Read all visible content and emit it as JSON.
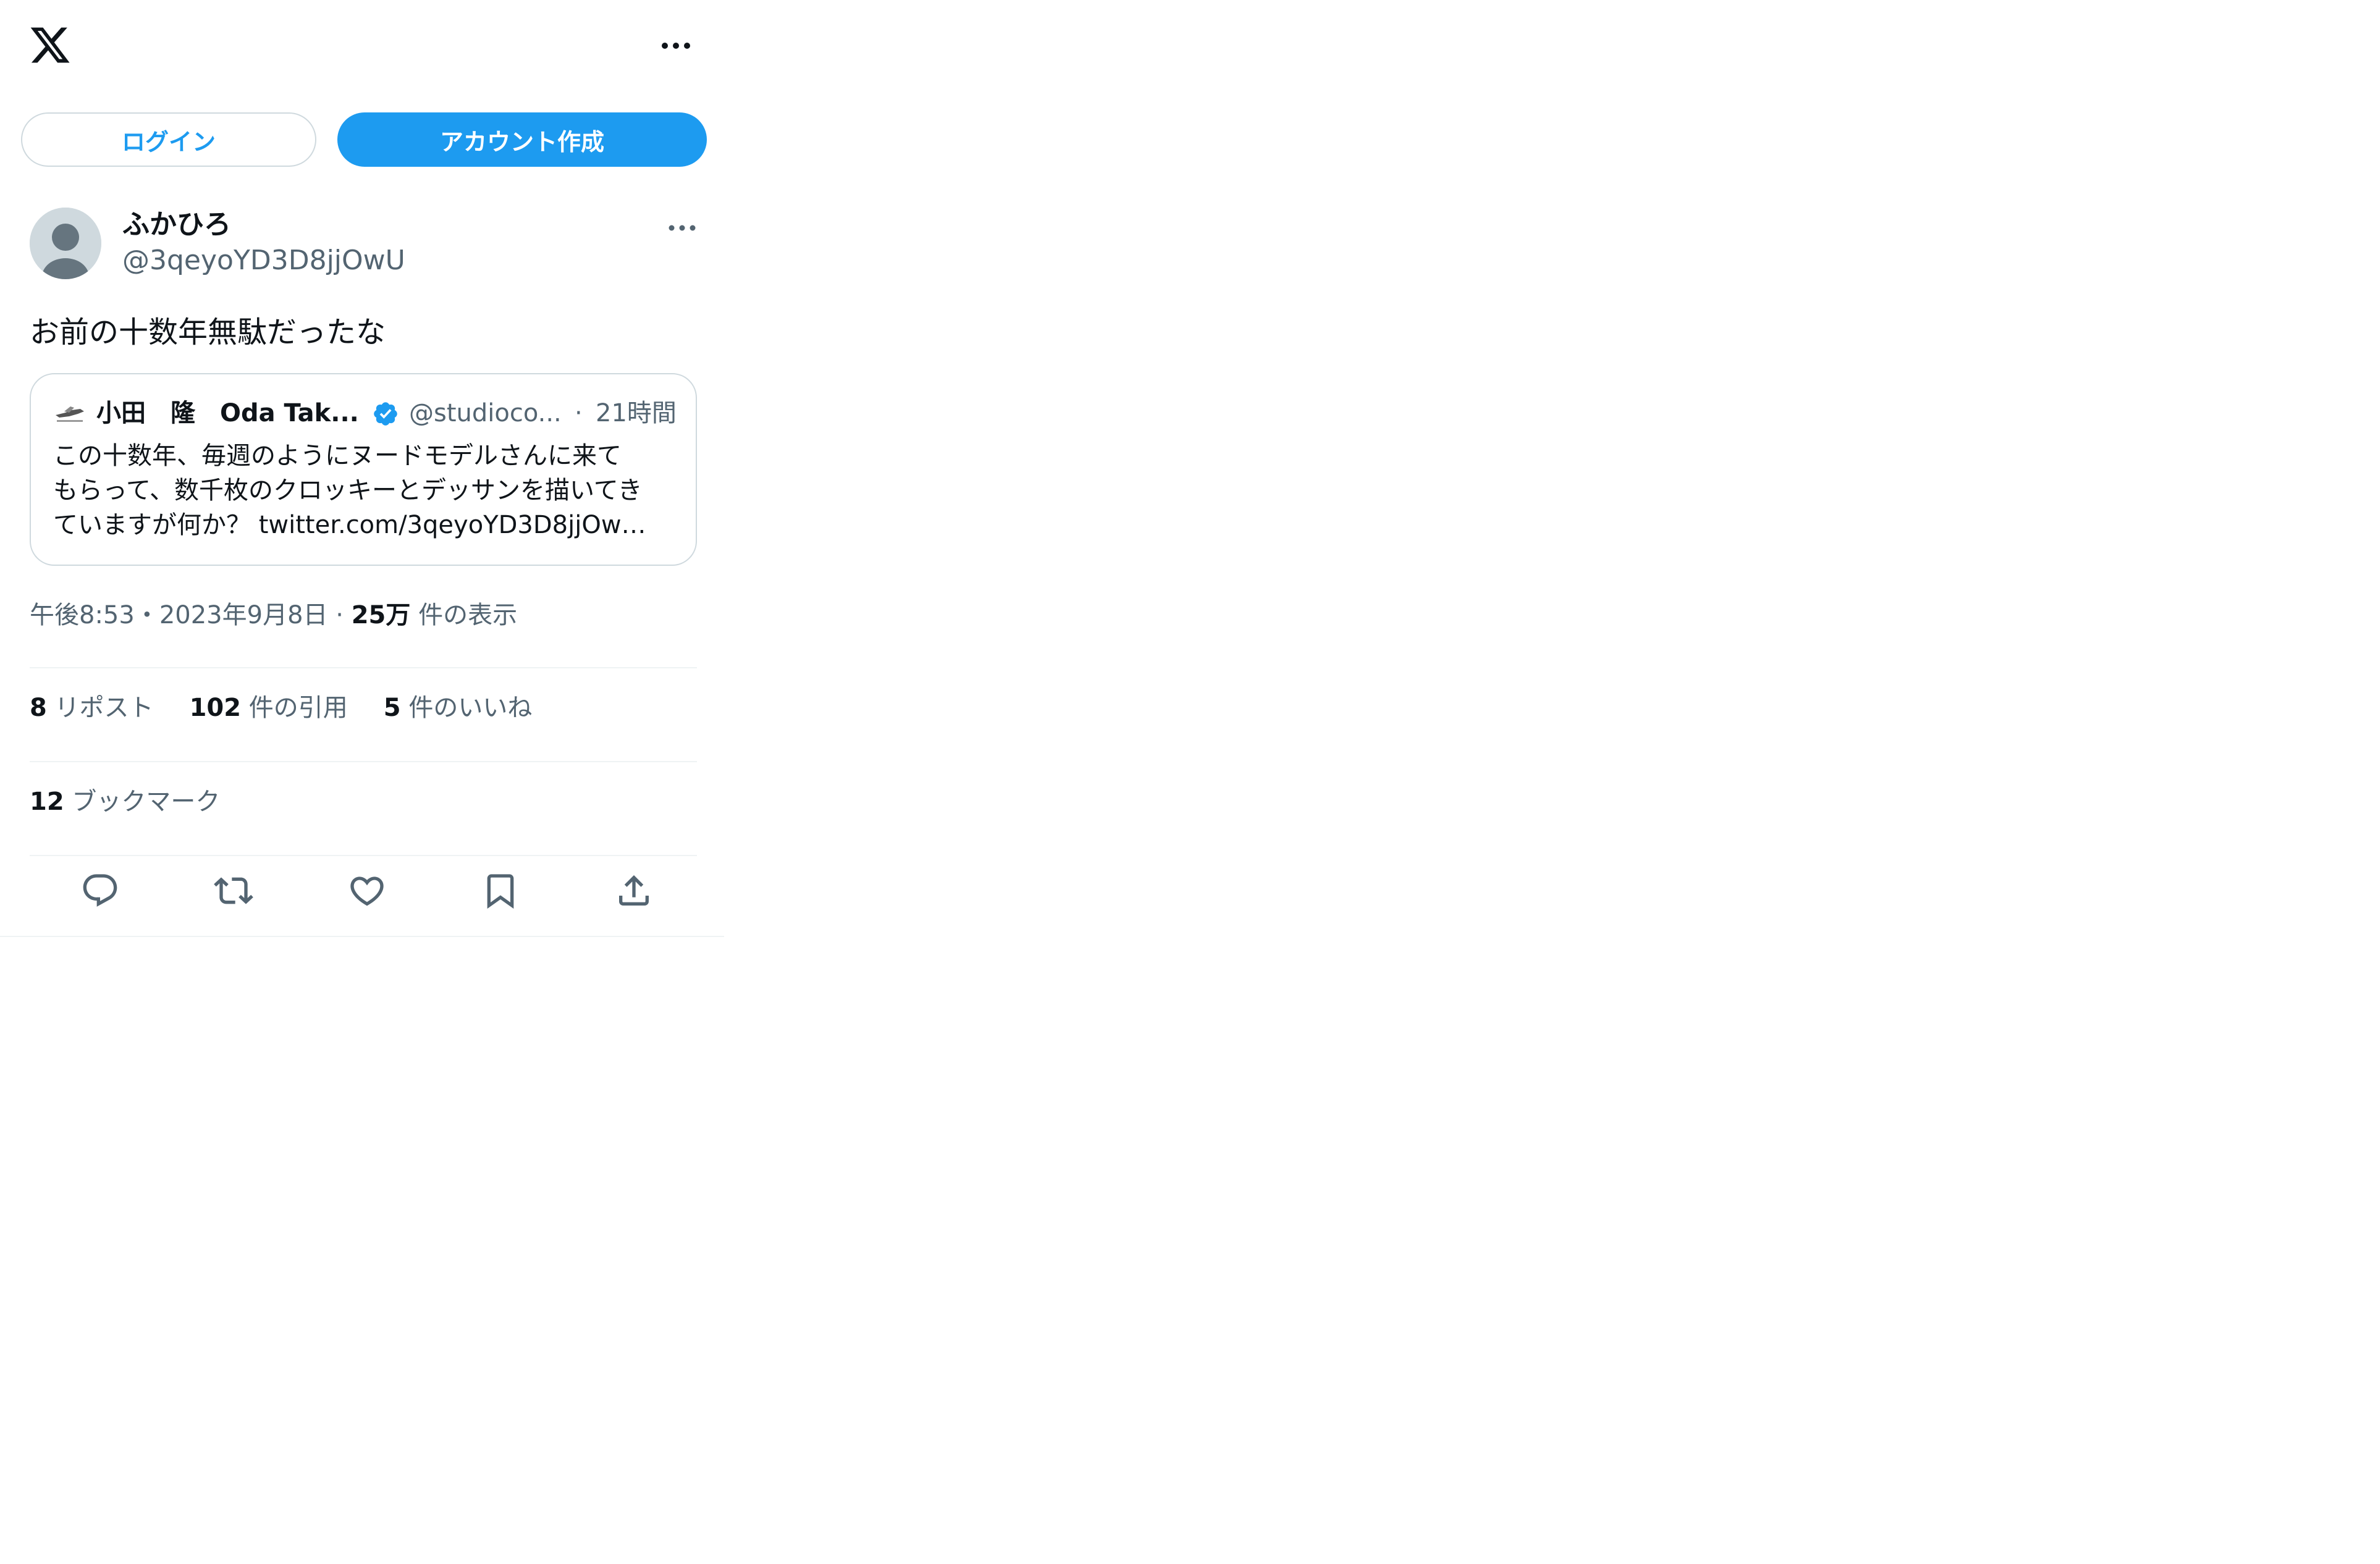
{
  "top_bar": {
    "logo_icon": "x-logo-icon",
    "more_icon": "more-horizontal-icon"
  },
  "auth_buttons": {
    "login_label": "ログイン",
    "signup_label": "アカウント作成"
  },
  "post": {
    "author_name": "ふかひろ",
    "author_handle": "@3qeyoYD3D8jjOwU",
    "text": "お前の十数年無駄だったな",
    "quote": {
      "author_name": "小田　隆　Oda Tak...",
      "verified": true,
      "author_handle": "@studioco...",
      "separator": "·",
      "time": "21時間",
      "lines": [
        "この十数年、毎週のようにヌードモデルさんに来て",
        "もらって、数千枚のクロッキーとデッサンを描いてき",
        "ていますが何か？ twitter.com/3qeyoYD3D8jjOw…"
      ]
    },
    "meta": {
      "time": "午後8:53",
      "sep1": "・",
      "date": "2023年9月8日",
      "sep2": " · ",
      "views_count": "25万",
      "views_label": " 件の表示"
    },
    "stats": {
      "reposts_count": "8",
      "reposts_label": " リポスト",
      "quotes_count": "102",
      "quotes_label": " 件の引用",
      "likes_count": "5",
      "likes_label": " 件のいいね"
    },
    "bookmarks": {
      "count": "12",
      "label": " ブックマーク"
    }
  },
  "actions": [
    {
      "icon": "reply-icon"
    },
    {
      "icon": "repost-icon"
    },
    {
      "icon": "like-icon"
    },
    {
      "icon": "bookmark-icon"
    },
    {
      "icon": "share-icon"
    }
  ],
  "colors": {
    "accent": "#1d9bf0",
    "text_primary": "#0f1419",
    "text_secondary": "#536471",
    "border": "#cfd9de",
    "divider": "#eff3f4"
  }
}
